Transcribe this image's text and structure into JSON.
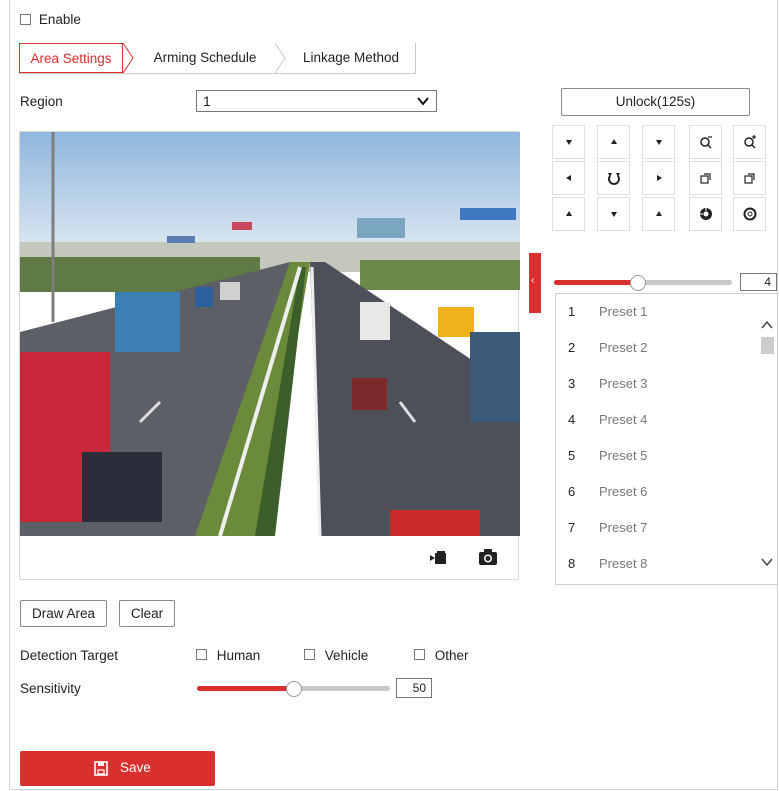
{
  "enable": {
    "label": "Enable",
    "checked": false
  },
  "tabs": [
    {
      "label": "Area Settings",
      "active": true
    },
    {
      "label": "Arming Schedule",
      "active": false
    },
    {
      "label": "Linkage Method",
      "active": false
    }
  ],
  "region": {
    "label": "Region",
    "value": "1"
  },
  "video": {
    "record_icon": "video-record-icon",
    "snapshot_icon": "camera-snapshot-icon"
  },
  "ptz": {
    "unlock_label": "Unlock(125s)",
    "controls": [
      "pan-up-left-icon",
      "pan-up-icon",
      "pan-up-right-icon",
      "zoom-out-icon",
      "zoom-in-icon",
      "pan-left-icon",
      "auto-rotate-icon",
      "pan-right-icon",
      "focus-near-icon",
      "focus-far-icon",
      "pan-down-left-icon",
      "pan-down-icon",
      "pan-down-right-icon",
      "iris-open-icon",
      "iris-close-icon"
    ],
    "speed": {
      "value": "4",
      "level_fraction": 0.47
    }
  },
  "presets": [
    {
      "num": "1",
      "name": "Preset 1"
    },
    {
      "num": "2",
      "name": "Preset 2"
    },
    {
      "num": "3",
      "name": "Preset 3"
    },
    {
      "num": "4",
      "name": "Preset 4"
    },
    {
      "num": "5",
      "name": "Preset 5"
    },
    {
      "num": "6",
      "name": "Preset 6"
    },
    {
      "num": "7",
      "name": "Preset 7"
    },
    {
      "num": "8",
      "name": "Preset 8"
    }
  ],
  "buttons": {
    "draw_area": "Draw Area",
    "clear": "Clear",
    "save": "Save"
  },
  "detection_target": {
    "label": "Detection Target",
    "options": [
      {
        "label": "Human",
        "checked": false
      },
      {
        "label": "Vehicle",
        "checked": false
      },
      {
        "label": "Other",
        "checked": false
      }
    ]
  },
  "sensitivity": {
    "label": "Sensitivity",
    "value": "50",
    "level_fraction": 0.5
  },
  "colors": {
    "accent": "#d8302e"
  }
}
